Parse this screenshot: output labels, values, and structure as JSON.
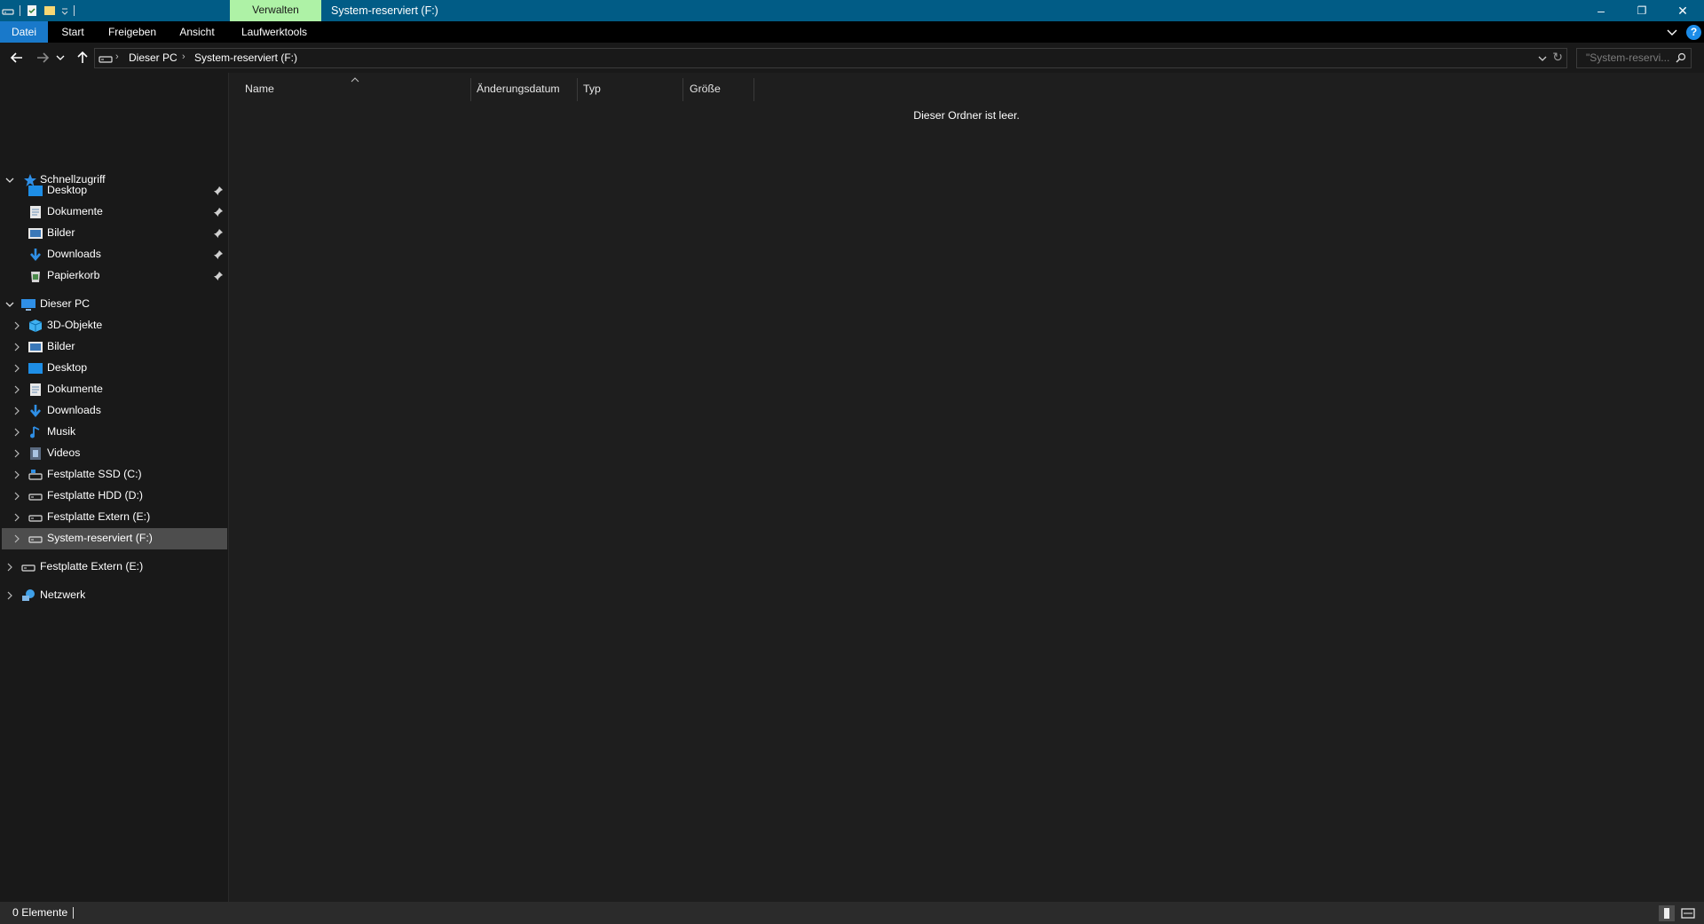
{
  "window": {
    "title": "System-reserviert (F:)",
    "context_tab": "Verwalten",
    "controls": {
      "minimize": "–",
      "maximize": "❐",
      "close": "✕"
    }
  },
  "ribbon": {
    "tabs": [
      "Datei",
      "Start",
      "Freigeben",
      "Ansicht",
      "Laufwerktools"
    ],
    "help": "?"
  },
  "address": {
    "breadcrumb": [
      "Dieser PC",
      "System-reserviert (F:)"
    ],
    "search_placeholder": "\"System-reservi..."
  },
  "nav": {
    "quick_access": {
      "label": "Schnellzugriff",
      "items": [
        {
          "label": "Desktop",
          "icon": "desktop-icon"
        },
        {
          "label": "Dokumente",
          "icon": "documents-icon"
        },
        {
          "label": "Bilder",
          "icon": "pictures-icon"
        },
        {
          "label": "Downloads",
          "icon": "downloads-icon"
        },
        {
          "label": "Papierkorb",
          "icon": "recycle-bin-icon"
        }
      ]
    },
    "this_pc": {
      "label": "Dieser PC",
      "items": [
        {
          "label": "3D-Objekte",
          "icon": "3d-objects-icon"
        },
        {
          "label": "Bilder",
          "icon": "pictures-icon"
        },
        {
          "label": "Desktop",
          "icon": "desktop-icon"
        },
        {
          "label": "Dokumente",
          "icon": "documents-icon"
        },
        {
          "label": "Downloads",
          "icon": "downloads-icon"
        },
        {
          "label": "Musik",
          "icon": "music-icon"
        },
        {
          "label": "Videos",
          "icon": "videos-icon"
        },
        {
          "label": "Festplatte SSD (C:)",
          "icon": "system-drive-icon"
        },
        {
          "label": "Festplatte HDD (D:)",
          "icon": "drive-icon"
        },
        {
          "label": "Festplatte Extern (E:)",
          "icon": "drive-icon"
        },
        {
          "label": "System-reserviert (F:)",
          "icon": "drive-icon",
          "selected": true
        }
      ]
    },
    "external": {
      "label": "Festplatte Extern (E:)"
    },
    "network": {
      "label": "Netzwerk"
    }
  },
  "content": {
    "columns": [
      "Name",
      "Änderungsdatum",
      "Typ",
      "Größe"
    ],
    "empty_message": "Dieser Ordner ist leer."
  },
  "status": {
    "item_count": "0 Elemente"
  },
  "colors": {
    "titlebar": "#015c86",
    "context_tab": "#aef2a6",
    "file_tab": "#1979ca",
    "selection": "#4d4d4d",
    "folder_blue": "#1e8ee6"
  }
}
